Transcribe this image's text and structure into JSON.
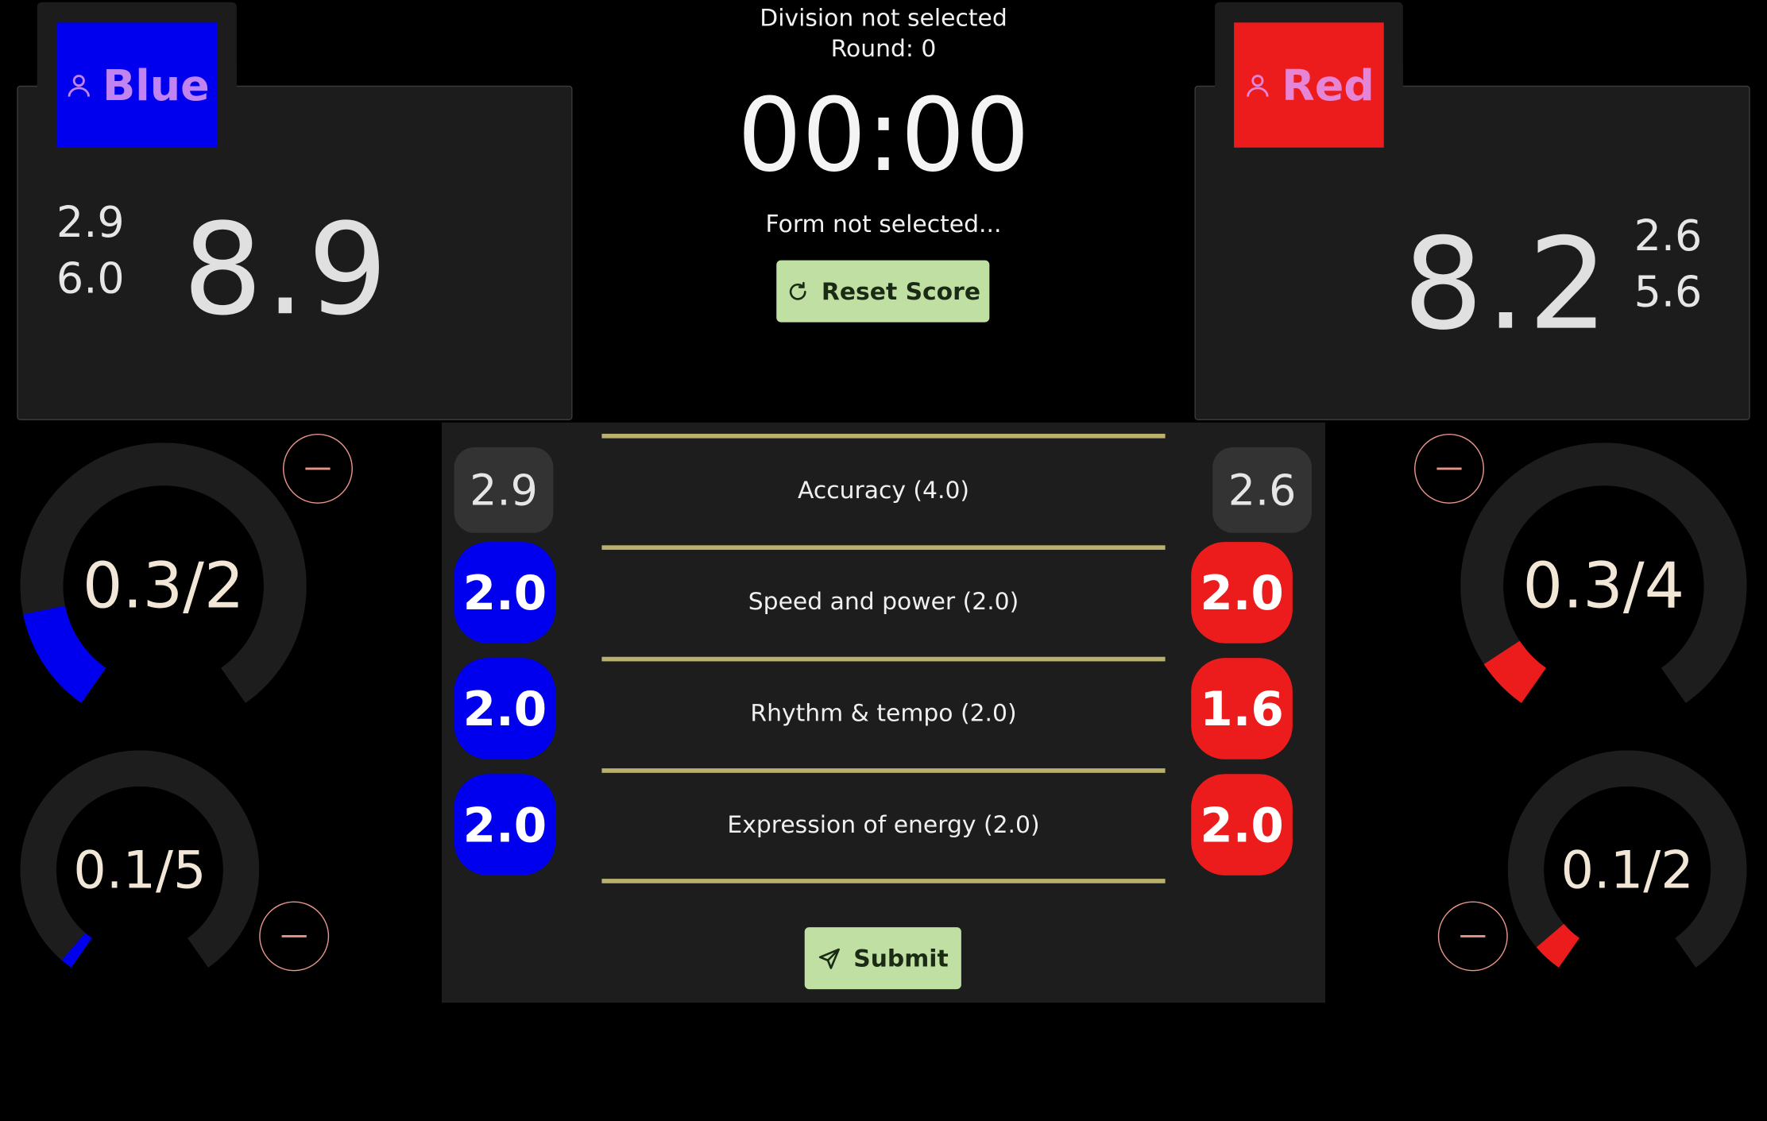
{
  "header": {
    "division": "Division not selected",
    "round": "Round: 0",
    "timer": "00:00",
    "form": "Form not selected...",
    "reset_label": "Reset Score"
  },
  "blue": {
    "name": "Blue",
    "color": "#0000ee",
    "accuracy": "2.9",
    "presentation": "6.0",
    "total": "8.9",
    "gauge_top": {
      "label": "0.3/2",
      "value": 0.3,
      "max": 2
    },
    "gauge_bottom": {
      "label": "0.1/5",
      "value": 0.1,
      "max": 5
    }
  },
  "red": {
    "name": "Red",
    "color": "#ec1c1c",
    "accuracy": "2.6",
    "presentation": "5.6",
    "total": "8.2",
    "gauge_top": {
      "label": "0.3/4",
      "value": 0.3,
      "max": 4
    },
    "gauge_bottom": {
      "label": "0.1/2",
      "value": 0.1,
      "max": 2
    }
  },
  "criteria": [
    {
      "label": "Accuracy (4.0)",
      "blue": "2.9",
      "red": "2.6"
    },
    {
      "label": "Speed and power (2.0)",
      "blue": "2.0",
      "red": "2.0"
    },
    {
      "label": "Rhythm & tempo (2.0)",
      "blue": "2.0",
      "red": "1.6"
    },
    {
      "label": "Expression of energy (2.0)",
      "blue": "2.0",
      "red": "2.0"
    }
  ],
  "submit_label": "Submit",
  "colors": {
    "accent_button": "#bfe0a2",
    "divider": "#b8b06c",
    "gauge_track": "#1d1d1d",
    "minus_outline": "#e8958b"
  }
}
